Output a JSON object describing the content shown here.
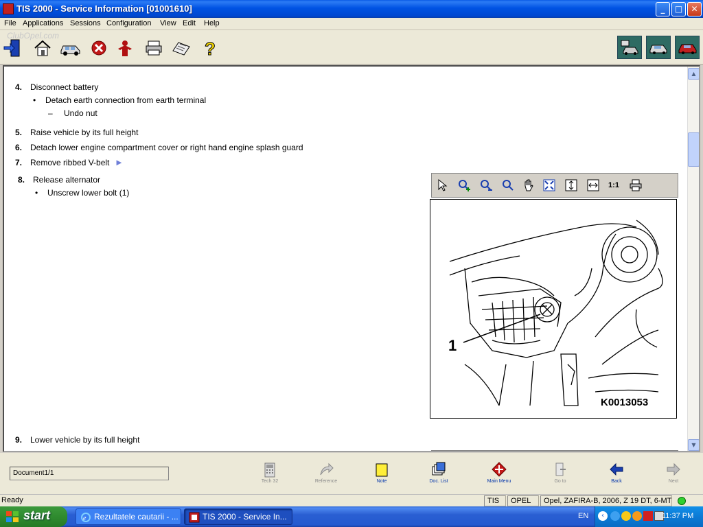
{
  "window": {
    "title": "TIS 2000 - Service Information [01001610]",
    "controls": {
      "minimize": "_",
      "maximize": "□",
      "close": "✕"
    }
  },
  "menu": [
    "File",
    "Applications",
    "Sessions",
    "Configuration",
    "View",
    "Edit",
    "Help"
  ],
  "watermark": "ClubOpel.com",
  "toolbar": {
    "left_icons": [
      "exit-icon",
      "home-icon",
      "vehicle-icon",
      "stop-icon",
      "person-icon",
      "print-icon",
      "keyboard-icon",
      "help-icon"
    ],
    "right_icons": [
      "mode-service-icon",
      "mode-diag-icon",
      "mode-vehicle-icon"
    ]
  },
  "document": {
    "steps": [
      {
        "num": "4.",
        "text": "Disconnect battery",
        "subs": [
          {
            "bullet": "•",
            "text": "Detach earth connection from earth terminal"
          },
          {
            "bullet": "–",
            "text": "Undo nut"
          }
        ]
      },
      {
        "num": "5.",
        "text": "Raise vehicle by its full height"
      },
      {
        "num": "6.",
        "text": "Detach lower engine compartment cover or right hand engine splash guard"
      },
      {
        "num": "7.",
        "text": "Remove ribbed V-belt"
      },
      {
        "num": "8.",
        "text": "Release alternator",
        "subs": [
          {
            "bullet": "•",
            "text": "Unscrew lower bolt (1)"
          }
        ]
      },
      {
        "num": "9.",
        "text": "Lower vehicle by its full height"
      }
    ],
    "link_arrow": "►"
  },
  "viewer": {
    "tools": [
      "pointer-icon",
      "zoom-in-icon",
      "zoom-out-icon",
      "zoom-icon",
      "pan-hand-icon",
      "fit-page-icon",
      "fit-height-icon",
      "fit-width-icon",
      "actual-size-icon",
      "print-image-icon"
    ],
    "actual_size_label": "1:1",
    "figure_callout": "1",
    "figure_code": "K0013053"
  },
  "nav": {
    "document_field": "Document1/1",
    "buttons": [
      {
        "label": "Tech 32",
        "enabled": false,
        "icon": "tech32-icon"
      },
      {
        "label": "Reference",
        "enabled": false,
        "icon": "reference-icon"
      },
      {
        "label": "Note",
        "enabled": true,
        "icon": "note-icon"
      },
      {
        "label": "Doc. List",
        "enabled": true,
        "icon": "doc-list-icon"
      },
      {
        "label": "Main Menu",
        "enabled": true,
        "icon": "main-menu-icon"
      },
      {
        "label": "Go to",
        "enabled": false,
        "icon": "goto-icon"
      },
      {
        "label": "Back",
        "enabled": true,
        "icon": "back-icon"
      },
      {
        "label": "Next",
        "enabled": false,
        "icon": "next-icon"
      }
    ]
  },
  "status": {
    "text": "Ready",
    "cells": [
      "TIS",
      "OPEL",
      "Opel, ZAFIRA-B, 2006, Z 19 DT, 6-MT"
    ]
  },
  "taskbar": {
    "start": "start",
    "tasks": [
      "Rezultatele cautarii - ...",
      "TIS 2000 - Service In..."
    ],
    "language": "EN",
    "time": "11:37 PM"
  }
}
